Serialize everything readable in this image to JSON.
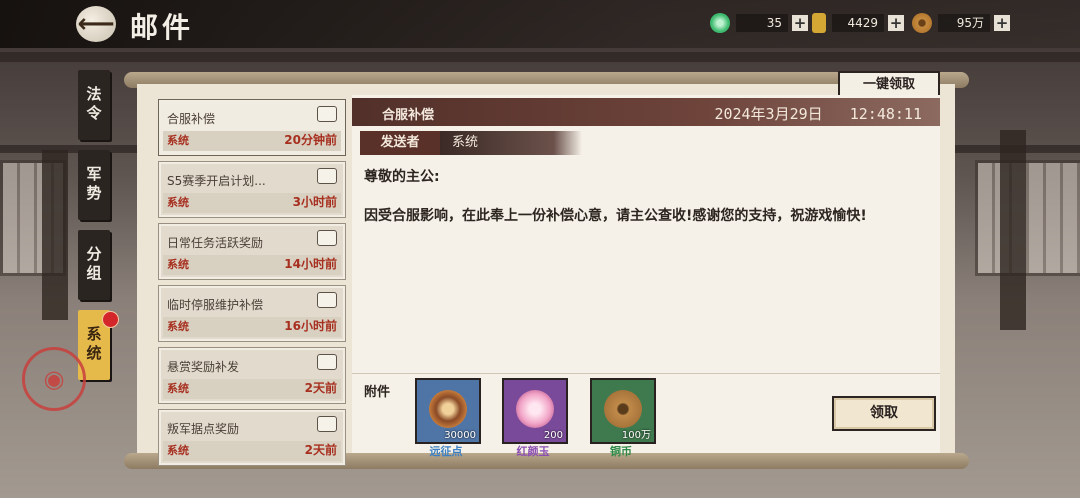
{
  "header": {
    "title": "邮件",
    "resources": [
      {
        "name": "jade",
        "value": "35",
        "color": "#3dbb6e"
      },
      {
        "name": "gold-ingot",
        "value": "4429",
        "color": "#d4a634"
      },
      {
        "name": "copper-coin",
        "value": "95万",
        "color": "#b5792f"
      }
    ]
  },
  "tabs": [
    "法令",
    "军势",
    "分组",
    "系统"
  ],
  "active_tab": "系统",
  "one_key_claim": "一键领取",
  "mails": [
    {
      "subject": "合服补偿",
      "from": "系统",
      "time": "20分钟前"
    },
    {
      "subject": "S5赛季开启计划...",
      "from": "系统",
      "time": "3小时前"
    },
    {
      "subject": "日常任务活跃奖励",
      "from": "系统",
      "time": "14小时前"
    },
    {
      "subject": "临时停服维护补偿",
      "from": "系统",
      "time": "16小时前"
    },
    {
      "subject": "悬赏奖励补发",
      "from": "系统",
      "time": "2天前"
    },
    {
      "subject": "叛军据点奖励",
      "from": "系统",
      "time": "2天前"
    }
  ],
  "detail": {
    "subject": "合服补偿",
    "date": "2024年3月29日",
    "time": "12:48:11",
    "sender_label": "发送者",
    "sender": "系统",
    "greeting": "尊敬的主公:",
    "content": "因受合服影响，在此奉上一份补偿心意，请主公查收!感谢您的支持，祝游戏愉快!",
    "attach_label": "附件",
    "attachments": [
      {
        "name": "远征点",
        "qty": "30000",
        "bg": "#4f74a6",
        "name_color": "#3b7fc4"
      },
      {
        "name": "红颜玉",
        "qty": "200",
        "bg": "#7a4a9a",
        "name_color": "#8c4fb3"
      },
      {
        "name": "铜币",
        "qty": "100万",
        "bg": "#3f7a4e",
        "name_color": "#2f8a47"
      }
    ],
    "claim_label": "领取"
  }
}
